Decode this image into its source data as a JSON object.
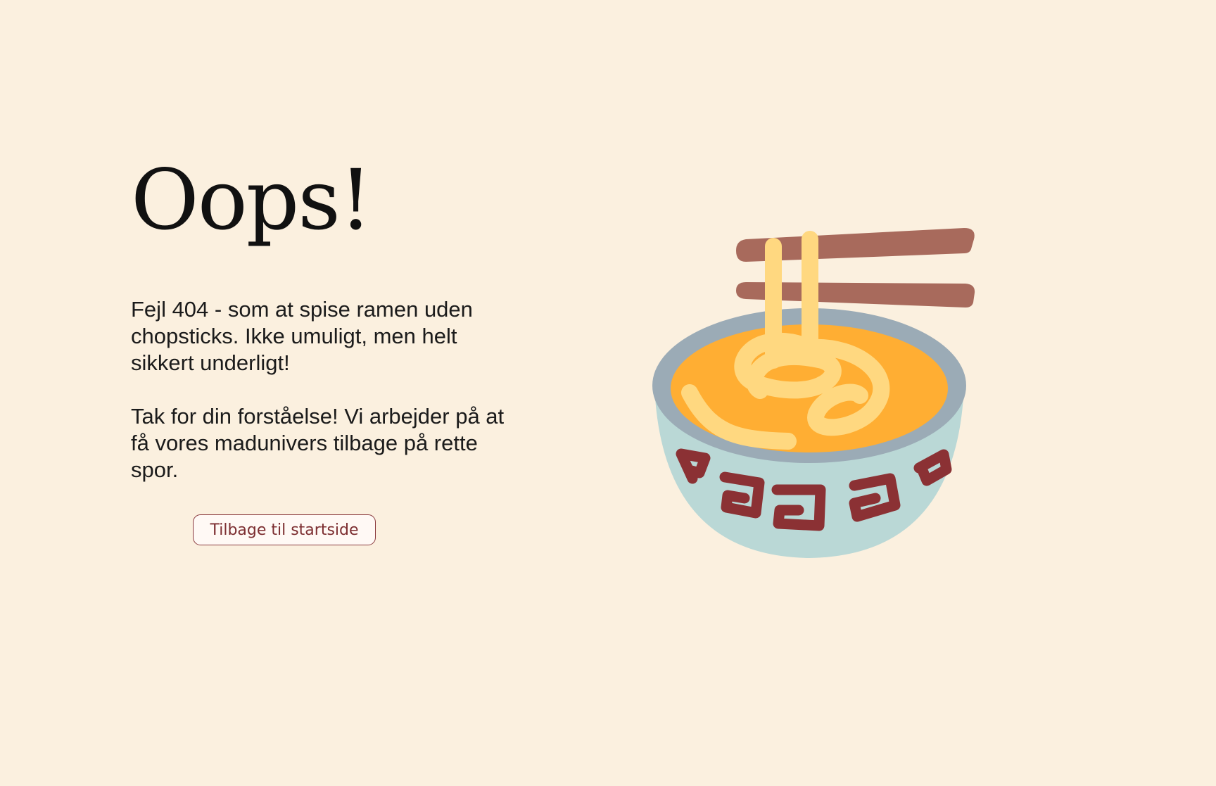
{
  "error": {
    "title": "Oops!",
    "message_line_1": "Fejl 404 - som at spise ramen uden chopsticks. Ikke umuligt, men helt sikkert underligt!",
    "message_line_2": "Tak for din forståelse! Vi arbejder på at få vores madunivers tilbage på rette spor."
  },
  "actions": {
    "back_label": "Tilbage til startside"
  },
  "illustration": {
    "icon": "ramen-bowl-icon",
    "colors": {
      "background": "#FBF0DF",
      "bowl_rim": "#9BABB6",
      "bowl_body": "#BAD8D6",
      "broth": "#FFAE33",
      "noodles": "#FFD880",
      "chopsticks": "#A86A5C",
      "pattern": "#8B3134",
      "button_border": "#8A3A3E"
    }
  }
}
